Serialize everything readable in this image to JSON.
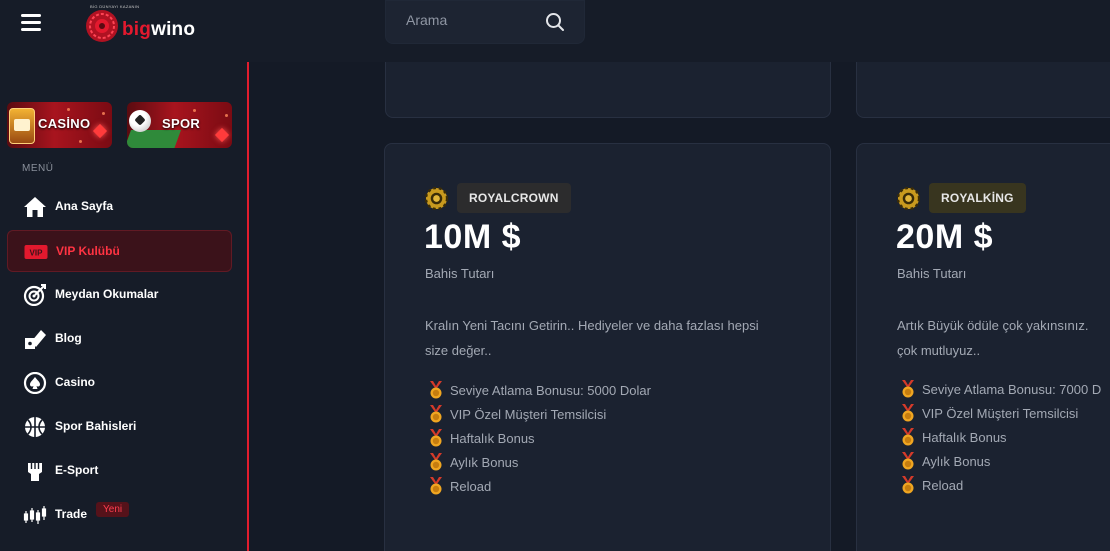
{
  "header": {
    "logo": {
      "brand_part1": "big",
      "brand_part2": "wino",
      "tagline": "BİG DÜNYAYI KAZANIN"
    },
    "search": {
      "placeholder": "Arama"
    }
  },
  "sidebar": {
    "tiles": [
      {
        "label": "CASİNO"
      },
      {
        "label": "SPOR"
      }
    ],
    "menu_label": "MENÜ",
    "items": [
      {
        "label": "Ana Sayfa",
        "icon": "home-icon",
        "active": false
      },
      {
        "label": "VIP Kulübü",
        "icon": "vip-icon",
        "active": true
      },
      {
        "label": "Meydan Okumalar",
        "icon": "target-icon",
        "active": false
      },
      {
        "label": "Blog",
        "icon": "blog-icon",
        "active": false
      },
      {
        "label": "Casino",
        "icon": "casino-chip-icon",
        "active": false
      },
      {
        "label": "Spor Bahisleri",
        "icon": "basketball-icon",
        "active": false
      },
      {
        "label": "E-Sport",
        "icon": "fist-icon",
        "active": false
      },
      {
        "label": "Trade",
        "icon": "candlestick-icon",
        "active": false
      }
    ],
    "trade_badge": "Yeni"
  },
  "vip_cards": [
    {
      "tier": "ROYALCROWN",
      "amount": "10M $",
      "amount_label": "Bahis Tutarı",
      "description": "Kralın Yeni Tacını Getirin.. Hediyeler ve daha fazlası hepsi size değer..",
      "perks": [
        "Seviye Atlama Bonusu: 5000 Dolar",
        "VIP Özel Müşteri Temsilcisi",
        "Haftalık Bonus",
        "Aylık Bonus",
        "Reload"
      ]
    },
    {
      "tier": "ROYALKİNG",
      "amount": "20M $",
      "amount_label": "Bahis Tutarı",
      "description": "Artık Büyük ödüle çok yakınsınız. çok mutluyuz..",
      "perks": [
        "Seviye Atlama Bonusu: 7000 D",
        "VIP Özel Müşteri Temsilcisi",
        "Haftalık Bonus",
        "Aylık Bonus",
        "Reload"
      ]
    }
  ],
  "colors": {
    "background": "#141a26",
    "panel": "#161c28",
    "card": "#1b2230",
    "accent_red": "#e11d2e",
    "muted_text": "#a3a9b4",
    "medal_gold": "#f0a621"
  }
}
